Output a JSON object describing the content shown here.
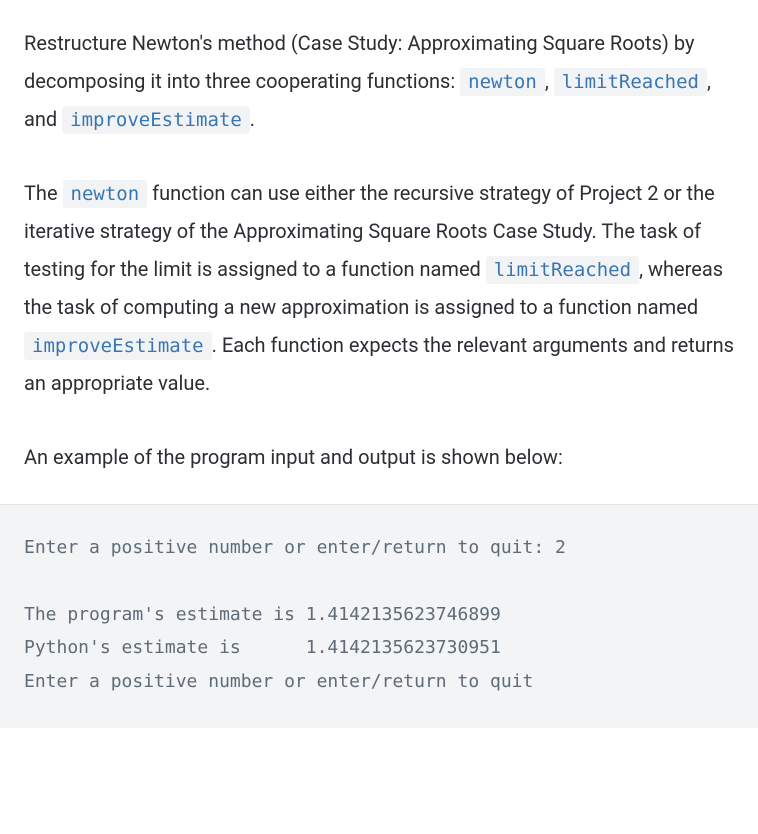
{
  "para1": {
    "t1": "Restructure Newton's method (Case Study: Approximating Square Roots) by decomposing it into three cooperating functions: ",
    "c1": "newton",
    "s1": ", ",
    "c2": "limitReached",
    "s2": ", and ",
    "c3": "improveEstimate",
    "s3": "."
  },
  "para2": {
    "t1": "The ",
    "c1": "newton",
    "t2": " function can use either the recursive strategy of Project 2 or the iterative strategy of the Approximating Square Roots Case Study. The task of testing for the limit is assigned to a function named ",
    "c2": "limitReached",
    "t3": ", whereas the task of computing a new approximation is assigned to a function named ",
    "c3": "improveEstimate",
    "t4": ". Each function expects the relevant arguments and returns an appropriate value."
  },
  "para3": {
    "t1": "An example of the program input and output is shown below:"
  },
  "code": "Enter a positive number or enter/return to quit: 2\n\nThe program's estimate is 1.4142135623746899\nPython's estimate is      1.4142135623730951\nEnter a positive number or enter/return to quit"
}
